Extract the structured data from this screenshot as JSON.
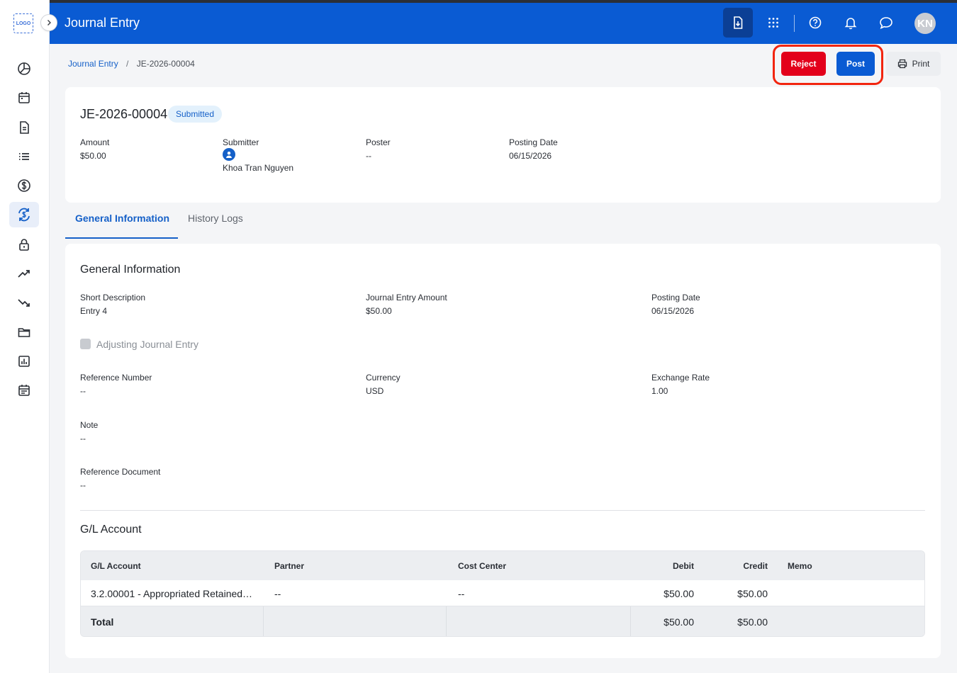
{
  "app": {
    "logo_text": "LOGO",
    "title": "Journal Entry",
    "user_initials": "KN"
  },
  "topbar_icons": [
    "download-doc-icon",
    "apps-grid-icon",
    "help-icon",
    "bell-icon",
    "chat-icon"
  ],
  "sidebar": {
    "items": [
      "dashboard-icon",
      "calendar-icon",
      "document-icon",
      "list-icon",
      "dollar-icon",
      "exchange-icon",
      "lock-icon",
      "trending-up-icon",
      "trending-down-icon",
      "folder-icon",
      "report-icon",
      "schedule-icon"
    ],
    "active_index": 5
  },
  "breadcrumb": {
    "parent": "Journal Entry",
    "separator": "/",
    "current": "JE-2026-00004"
  },
  "actions": {
    "reject": "Reject",
    "post": "Post",
    "print": "Print"
  },
  "summary": {
    "doc_id": "JE-2026-00004",
    "status": "Submitted",
    "amount_label": "Amount",
    "amount_value": "$50.00",
    "submitter_label": "Submitter",
    "submitter_value": "Khoa Tran Nguyen",
    "poster_label": "Poster",
    "poster_value": "--",
    "posting_date_label": "Posting Date",
    "posting_date_value": "06/15/2026"
  },
  "tabs": {
    "general": "General Information",
    "history": "History Logs"
  },
  "general": {
    "title": "General Information",
    "short_desc_label": "Short Description",
    "short_desc_value": "Entry 4",
    "je_amount_label": "Journal Entry Amount",
    "je_amount_value": "$50.00",
    "posting_date_label": "Posting Date",
    "posting_date_value": "06/15/2026",
    "adjusting_label": "Adjusting Journal Entry",
    "ref_number_label": "Reference Number",
    "ref_number_value": "--",
    "currency_label": "Currency",
    "currency_value": "USD",
    "exchange_rate_label": "Exchange Rate",
    "exchange_rate_value": "1.00",
    "note_label": "Note",
    "note_value": "--",
    "ref_doc_label": "Reference Document",
    "ref_doc_value": "--"
  },
  "gl": {
    "title": "G/L Account",
    "headers": {
      "account": "G/L Account",
      "partner": "Partner",
      "cost_center": "Cost Center",
      "debit": "Debit",
      "credit": "Credit",
      "memo": "Memo"
    },
    "row": {
      "account": "3.2.00001 - Appropriated Retained…",
      "partner": "--",
      "cost_center": "--",
      "debit": "$50.00",
      "credit": "$50.00",
      "memo": ""
    },
    "total": {
      "label": "Total",
      "debit": "$50.00",
      "credit": "$50.00"
    }
  }
}
